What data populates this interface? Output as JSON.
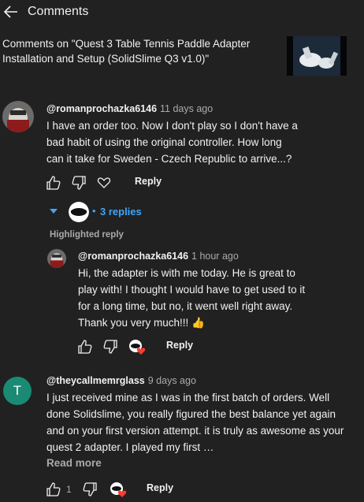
{
  "header": {
    "title": "Comments"
  },
  "video": {
    "title": "Comments on \"Quest 3 Table Tennis Paddle Adapter Installation and Setup (SolidSlime Q3 v1.0)\""
  },
  "comments": [
    {
      "author": "@romanprochazka6146",
      "time": "11 days ago",
      "text": "I have an order too. Now I don't play so I don't have a bad habit of using the original controller. How long can it take for Sweden - Czech Republic to arrive...?",
      "reply_label": "Reply"
    },
    {
      "author": "@romanprochazka6146",
      "time": "1 hour ago",
      "text": "Hi, the adapter is with me today. He is great to play with! I thought I would have to get used to it for a long time, but no, it went well right away. Thank you very much!!! 👍",
      "reply_label": "Reply"
    },
    {
      "author": "@theycallmemrglass",
      "time": "9 days ago",
      "avatar_letter": "T",
      "text": "I just received mine as I was in the first batch of orders. Well done Solidslime, you really figured the best balance yet again and on your first version attempt. it is truly as awesome as your quest 2 adapter. I played my first …",
      "like_count": "1",
      "reply_label": "Reply",
      "read_more": "Read more"
    }
  ],
  "replies": {
    "dot": "•",
    "label": "3 replies"
  },
  "highlighted_label": "Highlighted reply",
  "colors": {
    "accent": "#3ea6ff",
    "background": "#212121",
    "avatar_t": "#1a8a74"
  },
  "icons": [
    "back-arrow-icon",
    "thumbs-up-icon",
    "thumbs-down-icon",
    "heart-icon",
    "creator-heart-icon",
    "caret-down-icon"
  ]
}
